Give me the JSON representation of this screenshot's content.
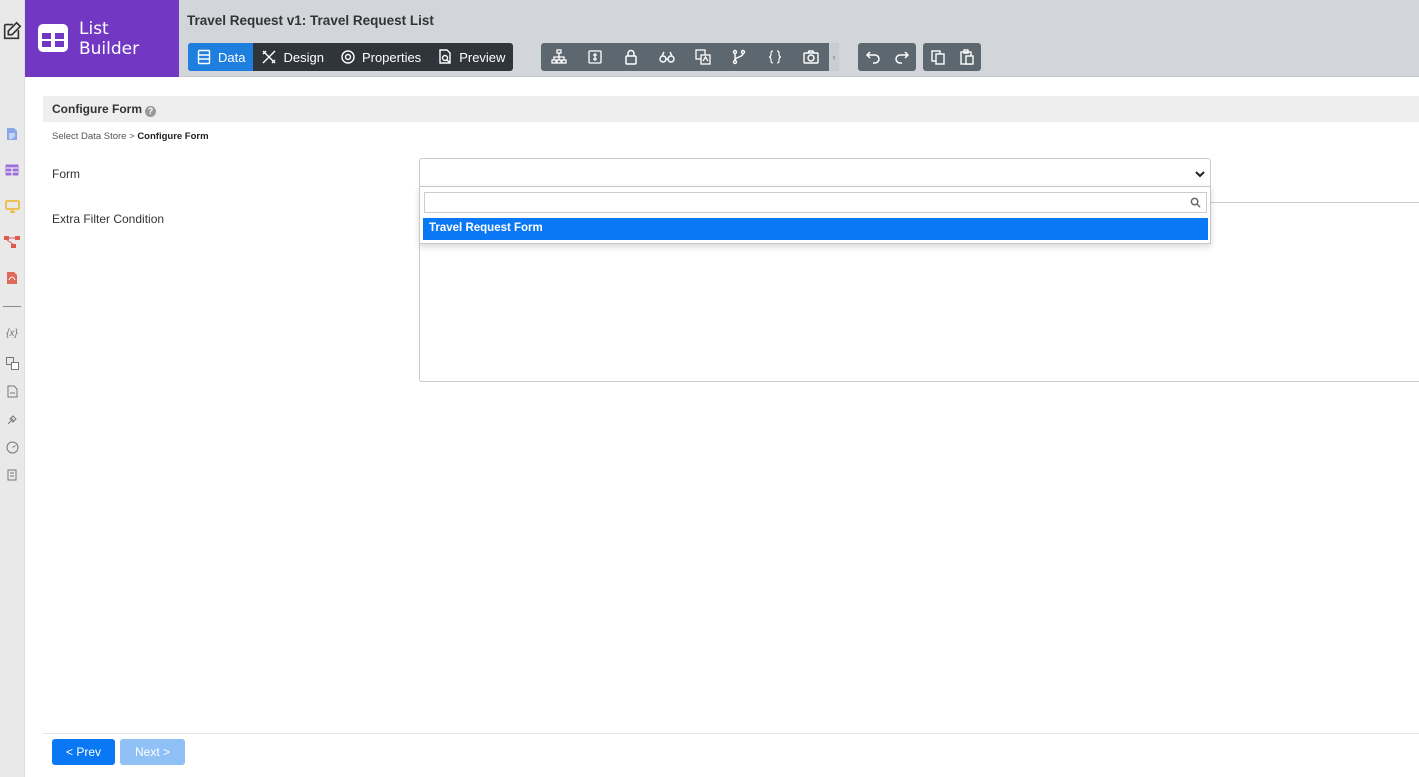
{
  "brand": {
    "line1": "List",
    "line2": "Builder"
  },
  "header": {
    "title": "Travel Request v1: Travel Request List"
  },
  "tabs": [
    {
      "label": "Data",
      "icon": "data-icon",
      "active": true
    },
    {
      "label": "Design",
      "icon": "design-tools-icon"
    },
    {
      "label": "Properties",
      "icon": "gear-icon"
    },
    {
      "label": "Preview",
      "icon": "preview-document-icon"
    }
  ],
  "toolbar": {
    "tools": [
      "hierarchy-icon",
      "permission-icon",
      "lock-icon",
      "binoculars-icon",
      "translate-icon",
      "branch-icon",
      "braces-icon",
      "camera-icon"
    ],
    "more": "›",
    "history": [
      "undo-icon",
      "redo-icon"
    ],
    "clipboard": [
      "copy-icon",
      "paste-icon"
    ]
  },
  "section": {
    "title": "Configure Form",
    "help": "?"
  },
  "breadcrumb": {
    "step1": "Select Data Store",
    "separator": ">",
    "step2": "Configure Form"
  },
  "form": {
    "form_label": "Form",
    "filter_label": "Extra Filter Condition",
    "selected_value": "",
    "dropdown": {
      "search_value": "",
      "options": [
        "Travel Request Form"
      ]
    }
  },
  "footer": {
    "prev_label": "< Prev",
    "next_label": "Next >"
  },
  "colors": {
    "brand": "#7238c4",
    "active_tab": "#1e7fde",
    "primary": "#0a78f5",
    "disabled": "#8fc1f7"
  }
}
